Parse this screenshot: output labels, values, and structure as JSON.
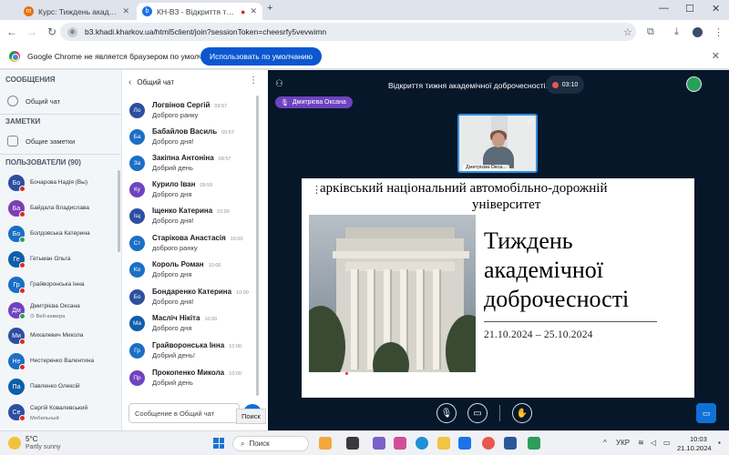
{
  "browser": {
    "tabs": [
      {
        "title": "Курс: Тиждень академічної д",
        "active": false,
        "favicon_color": "#e8710a"
      },
      {
        "title": "КН-В3 - Відкриття тижня а",
        "active": true,
        "favicon_color": "#1a73e8"
      }
    ],
    "new_tab_label": "+",
    "window_controls": {
      "minimize": "—",
      "maximize": "☐",
      "close": "✕"
    },
    "url": "b3.khadi.kharkov.ua/html5client/join?sessionToken=cheesrfy5vevwimn",
    "infobar": {
      "message": "Google Chrome не является браузером по умолчанию",
      "button": "Использовать по умолчанию"
    }
  },
  "sidebar": {
    "messages_heading": "СООБЩЕНИЯ",
    "public_chat": "Общий чат",
    "notes_heading": "ЗАМЕТКИ",
    "shared_notes": "Общие заметки",
    "users_heading": "ПОЛЬЗОВАТЕЛИ (90)",
    "users": [
      {
        "initials": "Бо",
        "name": "Бочарова Надія (Вы)",
        "color": "#2c4fa0",
        "muted": true
      },
      {
        "initials": "Ба",
        "name": "Байдала Владислава",
        "color": "#7b3fb3",
        "muted": true
      },
      {
        "initials": "Бо",
        "name": "Болдовська Катерина",
        "color": "#1b6fc5",
        "muted": false
      },
      {
        "initials": "Ге",
        "name": "Гетьман Ольга",
        "color": "#0f5ea8",
        "muted": true
      },
      {
        "initials": "Гр",
        "name": "Грайворонська Інна",
        "color": "#1b6fc5",
        "muted": true
      },
      {
        "initials": "Дм",
        "name": "Дмитрієва Оксана",
        "sub": "Веб-камера",
        "color": "#6f43c0",
        "muted": false
      },
      {
        "initials": "Ми",
        "name": "Михалевич Микола",
        "color": "#2c4fa0",
        "muted": true
      },
      {
        "initials": "Не",
        "name": "Нестеренко Валентина",
        "color": "#1b6fc5",
        "muted": true
      },
      {
        "initials": "Па",
        "name": "Павленко Олексій",
        "color": "#0f5ea8",
        "muted": false
      },
      {
        "initials": "Се",
        "name": "Сергій Ковалевський",
        "sub": "Мобильный",
        "color": "#2c4fa0",
        "muted": true
      }
    ]
  },
  "chat": {
    "title": "Общий чат",
    "messages": [
      {
        "initials": "Ло",
        "name": "Логвінов Сергій",
        "time": "09:57",
        "text": "Доброго ранку",
        "color": "#2c4fa0"
      },
      {
        "initials": "Ба",
        "name": "Бабайлов Василь",
        "time": "09:57",
        "text": "Доброго дня!",
        "color": "#1b6fc5"
      },
      {
        "initials": "За",
        "name": "Закіпна Антоніна",
        "time": "09:57",
        "text": "Добрий день",
        "color": "#1b6fc5"
      },
      {
        "initials": "Ку",
        "name": "Курило Іван",
        "time": "09:59",
        "text": "Доброго дня",
        "color": "#6f43c0"
      },
      {
        "initials": "Іщ",
        "name": "Іщенко Катерина",
        "time": "10:00",
        "text": "Доброго дня!",
        "color": "#2c4fa0"
      },
      {
        "initials": "Ст",
        "name": "Старікова Анастасія",
        "time": "10:00",
        "text": "доброго ранку",
        "color": "#1b6fc5"
      },
      {
        "initials": "Ко",
        "name": "Король Роман",
        "time": "10:00",
        "text": "Доброго дня",
        "color": "#1b6fc5"
      },
      {
        "initials": "Бо",
        "name": "Бондаренко Катерина",
        "time": "10:00",
        "text": "Доброго дня!",
        "color": "#2c4fa0"
      },
      {
        "initials": "Ма",
        "name": "Масліч Нікіта",
        "time": "10:00",
        "text": "Доброго дня",
        "color": "#0f5ea8"
      },
      {
        "initials": "Гр",
        "name": "Грайворонська Інна",
        "time": "10:00",
        "text": "Добрий день!",
        "color": "#1b6fc5"
      },
      {
        "initials": "Пр",
        "name": "Прокопенко Микола",
        "time": "10:00",
        "text": "Добрий день",
        "color": "#6f43c0"
      }
    ],
    "input_placeholder": "Сообщение в Общий чат",
    "send_tooltip": "Поиск"
  },
  "meeting": {
    "title": "Відкриття тижня академічної доброчесності...",
    "recording_time": "03:10",
    "talking_user": "Дмитрієва Оксана",
    "webcam_label": "Дмитрієва Окса..."
  },
  "slide": {
    "line1": "арківський національний автомобільно-дорожній",
    "line2": "університет",
    "title_lines": [
      "Тиждень",
      "академічної",
      "доброчесності"
    ],
    "dates": "21.10.2024 – 25.10.2024"
  },
  "taskbar": {
    "temperature": "5°C",
    "weather": "Partly sunny",
    "search": "Поиск",
    "language": "УКР",
    "time": "10:03",
    "date": "21.10.2024"
  }
}
